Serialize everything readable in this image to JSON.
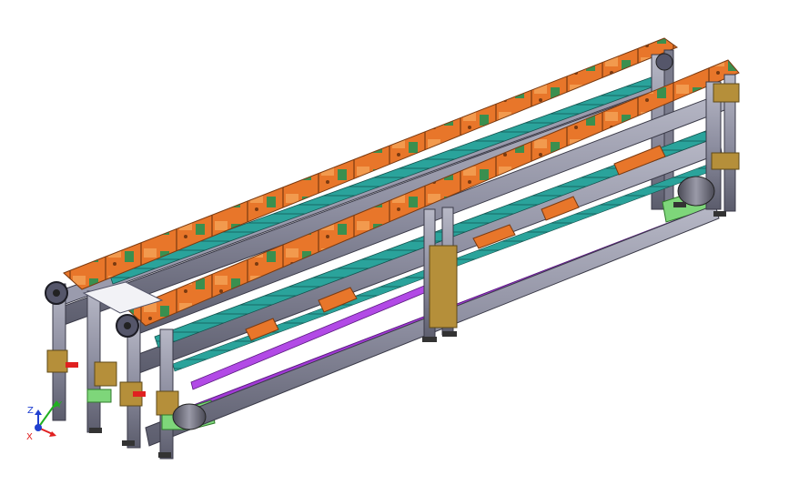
{
  "colors": {
    "background": "#ffffff",
    "frame": "#8d8ea0",
    "frame_dark": "#55566a",
    "frame_edge": "#3a3a48",
    "pallet": "#e8762a",
    "pallet_edge": "#7a3a10",
    "fixture": "#2e8b4a",
    "rail": "#2aa39b",
    "belt": "#a23ad6",
    "bracket": "#b58f3a",
    "plate": "#f2f2f6",
    "base_plate": "#7ed67a",
    "motor": "#6c6c78"
  },
  "triad": {
    "x_label": "X",
    "y_label": "Y",
    "z_label": "Z",
    "x_color": "#e02020",
    "y_color": "#20b020",
    "z_color": "#2040d0"
  }
}
